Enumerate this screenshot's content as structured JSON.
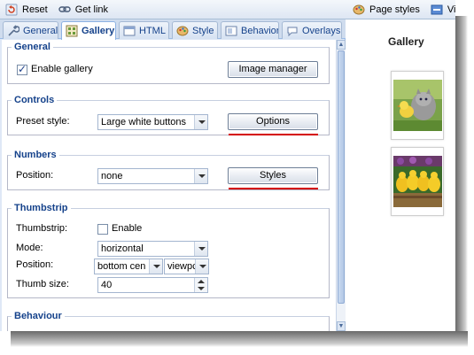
{
  "toolbar": {
    "reset_label": "Reset",
    "getlink_label": "Get link"
  },
  "tabs": [
    {
      "label": "General",
      "icon": "wrench-icon"
    },
    {
      "label": "Gallery",
      "icon": "gallery-icon",
      "active": true
    },
    {
      "label": "HTML",
      "icon": "html-icon"
    },
    {
      "label": "Style",
      "icon": "palette-icon"
    },
    {
      "label": "Behavior",
      "icon": "behavior-icon"
    },
    {
      "label": "Overlays",
      "icon": "speech-bubble-icon"
    }
  ],
  "sections": {
    "general": {
      "legend": "General",
      "enable_gallery_label": "Enable gallery",
      "enable_gallery_checked": true,
      "image_manager_button": "Image manager"
    },
    "controls": {
      "legend": "Controls",
      "preset_label": "Preset style:",
      "preset_value": "Large white buttons",
      "options_button": "Options"
    },
    "numbers": {
      "legend": "Numbers",
      "position_label": "Position:",
      "position_value": "none",
      "styles_button": "Styles"
    },
    "thumbstrip": {
      "legend": "Thumbstrip",
      "thumbstrip_label": "Thumbstrip:",
      "enable_label": "Enable",
      "enable_checked": false,
      "mode_label": "Mode:",
      "mode_value": "horizontal",
      "position_label": "Position:",
      "position_value": "bottom cen",
      "position_relative_value": "viewpc",
      "thumbsize_label": "Thumb size:",
      "thumbsize_value": "40"
    },
    "behaviour": {
      "legend": "Behaviour"
    }
  },
  "right_pane": {
    "page_styles_label": "Page styles",
    "view_label": "Vie",
    "gallery_title": "Gallery"
  },
  "colors": {
    "accent": "#15428b",
    "panel_bg": "#dfe8f6",
    "annotation_red": "#d40000"
  }
}
